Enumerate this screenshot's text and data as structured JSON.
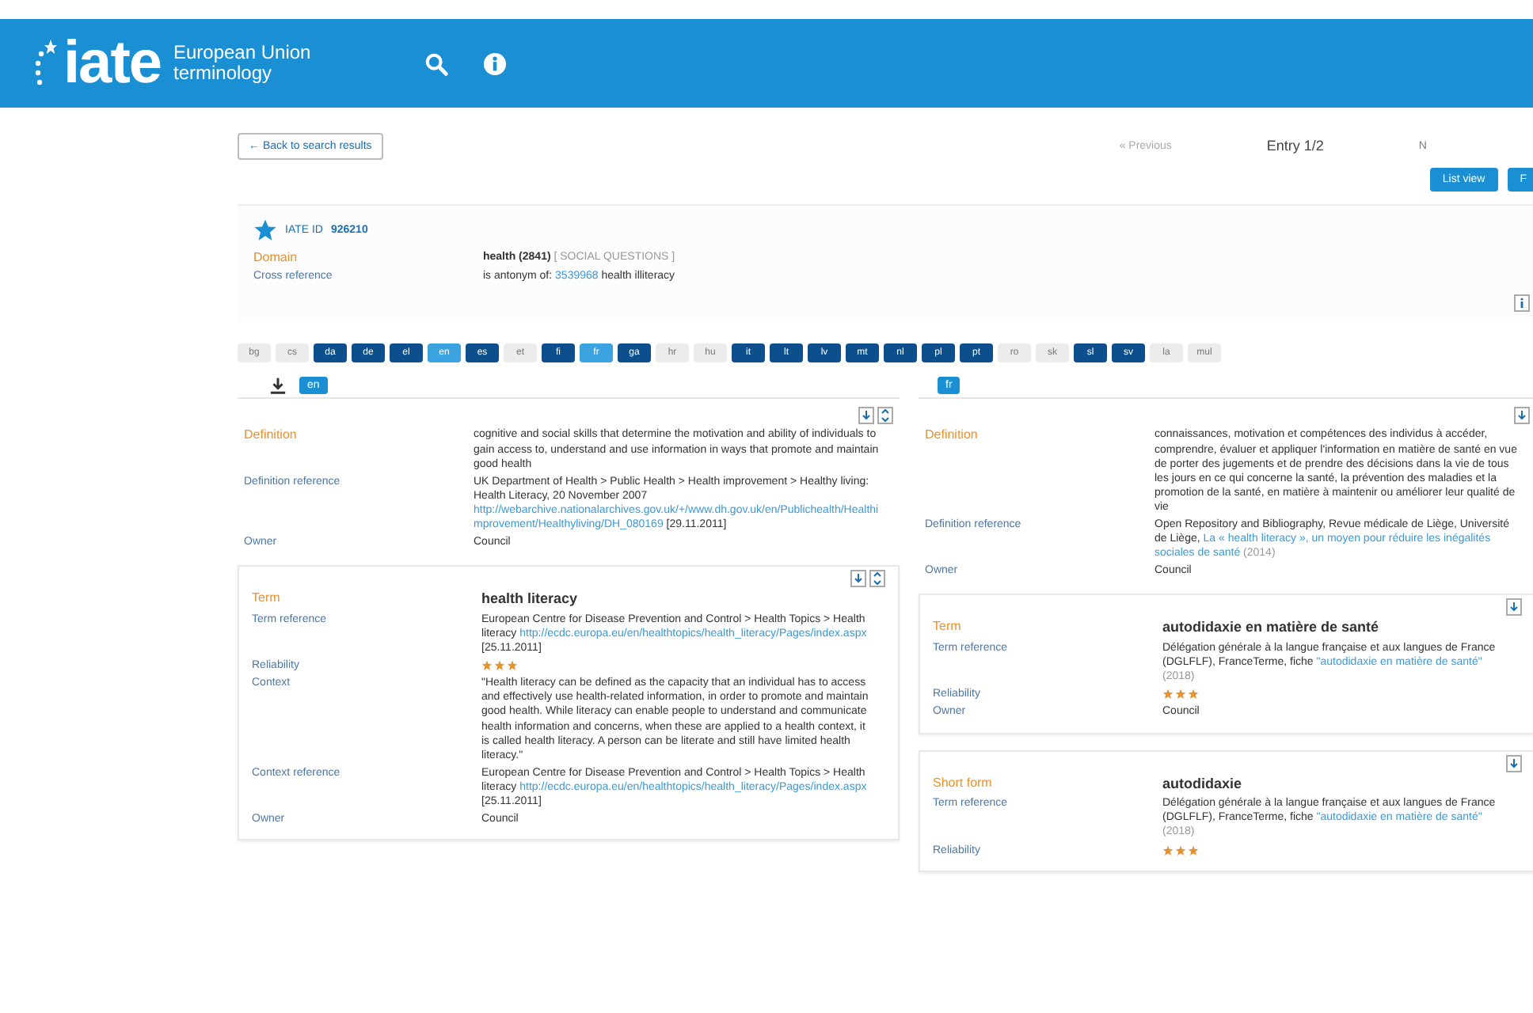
{
  "header": {
    "logo": "iate",
    "subtitle": [
      "European Union",
      "terminology"
    ]
  },
  "nav": {
    "back": "← Back to search results",
    "previous": "« Previous",
    "entry": "Entry 1/2",
    "next": "N",
    "buttons": [
      {
        "label": "List view"
      },
      {
        "label": "F"
      }
    ]
  },
  "entry": {
    "favorite": true,
    "id_label": "IATE ID",
    "id": "926210",
    "fields": [
      {
        "label": "Domain",
        "kind": "main",
        "value": [
          {
            "t": "health (2841)",
            "kind": "bold"
          },
          {
            "t": " [ SOCIAL QUESTIONS ]",
            "kind": "muted"
          }
        ]
      },
      {
        "label": "Cross reference",
        "kind": "detail",
        "value": [
          {
            "t": "is antonym of: ",
            "kind": "plain"
          },
          {
            "t": "3539968",
            "kind": "link"
          },
          {
            "t": " health illiteracy",
            "kind": "plain"
          }
        ]
      }
    ]
  },
  "languages": [
    {
      "code": "bg",
      "available": false,
      "selected": false
    },
    {
      "code": "cs",
      "available": false,
      "selected": false
    },
    {
      "code": "da",
      "available": true,
      "selected": false
    },
    {
      "code": "de",
      "available": true,
      "selected": false
    },
    {
      "code": "el",
      "available": true,
      "selected": false
    },
    {
      "code": "en",
      "available": true,
      "selected": true
    },
    {
      "code": "es",
      "available": true,
      "selected": false
    },
    {
      "code": "et",
      "available": false,
      "selected": false
    },
    {
      "code": "fi",
      "available": true,
      "selected": false
    },
    {
      "code": "fr",
      "available": true,
      "selected": true
    },
    {
      "code": "ga",
      "available": true,
      "selected": false
    },
    {
      "code": "hr",
      "available": false,
      "selected": false
    },
    {
      "code": "hu",
      "available": false,
      "selected": false
    },
    {
      "code": "it",
      "available": true,
      "selected": false
    },
    {
      "code": "lt",
      "available": true,
      "selected": false
    },
    {
      "code": "lv",
      "available": true,
      "selected": false
    },
    {
      "code": "mt",
      "available": true,
      "selected": false
    },
    {
      "code": "nl",
      "available": true,
      "selected": false
    },
    {
      "code": "pl",
      "available": true,
      "selected": false
    },
    {
      "code": "pt",
      "available": true,
      "selected": false
    },
    {
      "code": "ro",
      "available": false,
      "selected": false
    },
    {
      "code": "sk",
      "available": false,
      "selected": false
    },
    {
      "code": "sl",
      "available": true,
      "selected": false
    },
    {
      "code": "sv",
      "available": true,
      "selected": false
    },
    {
      "code": "la",
      "available": false,
      "selected": false
    },
    {
      "code": "mul",
      "available": false,
      "selected": false
    }
  ],
  "columns": [
    {
      "lang": "en",
      "download": true,
      "blocks": [
        {
          "kind": "definition",
          "fields": [
            {
              "label": "Definition",
              "kind": "main",
              "value": [
                {
                  "t": "cognitive and social skills that determine the motivation and ability of individuals to gain access to, understand and use information in ways that promote and maintain good health",
                  "kind": "plain"
                }
              ]
            },
            {
              "label": "Definition reference",
              "kind": "detail",
              "value": [
                {
                  "t": "UK Department of Health > Public Health > Health improvement > Healthy living: Health Literacy, 20 November 2007 ",
                  "kind": "plain"
                },
                {
                  "t": "http://webarchive.nationalarchives.gov.uk/+/www.dh.gov.uk/en/Publichealth/Healthimprovement/Healthyliving/DH_080169",
                  "kind": "link"
                },
                {
                  "t": " [29.11.2011]",
                  "kind": "plain"
                }
              ]
            },
            {
              "label": "Owner",
              "kind": "detail",
              "value": [
                {
                  "t": "Council",
                  "kind": "plain"
                }
              ]
            }
          ]
        },
        {
          "kind": "term",
          "fields": [
            {
              "label": "Term",
              "kind": "main",
              "value": [
                {
                  "t": "health literacy",
                  "kind": "bold"
                }
              ]
            },
            {
              "label": "Term reference",
              "kind": "detail",
              "value": [
                {
                  "t": "European Centre for Disease Prevention and Control > Health Topics > Health literacy ",
                  "kind": "plain"
                },
                {
                  "t": "http://ecdc.europa.eu/en/healthtopics/health_literacy/Pages/index.aspx",
                  "kind": "link"
                },
                {
                  "t": " [25.11.2011]",
                  "kind": "plain"
                }
              ]
            },
            {
              "label": "Reliability",
              "kind": "detail",
              "stars": 3
            },
            {
              "label": "Context",
              "kind": "detail",
              "value": [
                {
                  "t": "\"Health literacy can be defined as the capacity that an individual has to access and effectively use health-related information, in order to promote and maintain good health. While literacy can enable people to understand and communicate health information and concerns, when these are applied to a health context, it is called health literacy. A person can be literate and still have limited health literacy.\"",
                  "kind": "plain"
                }
              ]
            },
            {
              "label": "Context reference",
              "kind": "detail",
              "value": [
                {
                  "t": "European Centre for Disease Prevention and Control > Health Topics > Health literacy ",
                  "kind": "plain"
                },
                {
                  "t": "http://ecdc.europa.eu/en/healthtopics/health_literacy/Pages/index.aspx",
                  "kind": "link"
                },
                {
                  "t": " [25.11.2011]",
                  "kind": "plain"
                }
              ]
            },
            {
              "label": "Owner",
              "kind": "detail",
              "value": [
                {
                  "t": "Council",
                  "kind": "plain"
                }
              ]
            }
          ]
        }
      ]
    },
    {
      "lang": "fr",
      "download": false,
      "blocks": [
        {
          "kind": "definition",
          "fields": [
            {
              "label": "Definition",
              "kind": "main",
              "value": [
                {
                  "t": "connaissances, motivation et compétences des individus à accéder, comprendre, évaluer et appliquer l'information en matière de santé en vue de porter des jugements et de prendre des décisions dans la vie de tous les jours en ce qui concerne la santé, la prévention des maladies et la promotion de la santé, en matière à maintenir ou améliorer leur qualité de vie",
                  "kind": "plain"
                }
              ]
            },
            {
              "label": "Definition reference",
              "kind": "detail",
              "value": [
                {
                  "t": "Open Repository and Bibliography, Revue médicale de Liège, Université de Liège, ",
                  "kind": "plain"
                },
                {
                  "t": "La « health literacy », un moyen pour réduire les inégalités sociales de santé",
                  "kind": "link"
                },
                {
                  "t": " (2014)",
                  "kind": "muted"
                }
              ]
            },
            {
              "label": "Owner",
              "kind": "detail",
              "value": [
                {
                  "t": "Council",
                  "kind": "plain"
                }
              ]
            }
          ]
        },
        {
          "kind": "term",
          "fields": [
            {
              "label": "Term",
              "kind": "main",
              "value": [
                {
                  "t": "autodidaxie en matière de santé",
                  "kind": "bold"
                }
              ]
            },
            {
              "label": "Term reference",
              "kind": "detail",
              "value": [
                {
                  "t": "Délégation générale à la langue française et aux langues de France (DGLFLF), FranceTerme, fiche ",
                  "kind": "plain"
                },
                {
                  "t": "\"autodidaxie en matière de santé\"",
                  "kind": "link"
                },
                {
                  "t": " (2018)",
                  "kind": "muted"
                }
              ]
            },
            {
              "label": "Reliability",
              "kind": "detail",
              "stars": 3
            },
            {
              "label": "Owner",
              "kind": "detail",
              "value": [
                {
                  "t": "Council",
                  "kind": "plain"
                }
              ]
            }
          ]
        },
        {
          "kind": "term",
          "fields": [
            {
              "label": "Short form",
              "kind": "main",
              "value": [
                {
                  "t": "autodidaxie",
                  "kind": "bold"
                }
              ]
            },
            {
              "label": "Term reference",
              "kind": "detail",
              "value": [
                {
                  "t": "Délégation générale à la langue française et aux langues de France (DGLFLF), FranceTerme, fiche ",
                  "kind": "plain"
                },
                {
                  "t": "\"autodidaxie en matière de santé\"",
                  "kind": "link"
                },
                {
                  "t": " (2018)",
                  "kind": "muted"
                }
              ]
            },
            {
              "label": "Reliability",
              "kind": "detail",
              "stars": 3
            }
          ]
        }
      ]
    }
  ]
}
